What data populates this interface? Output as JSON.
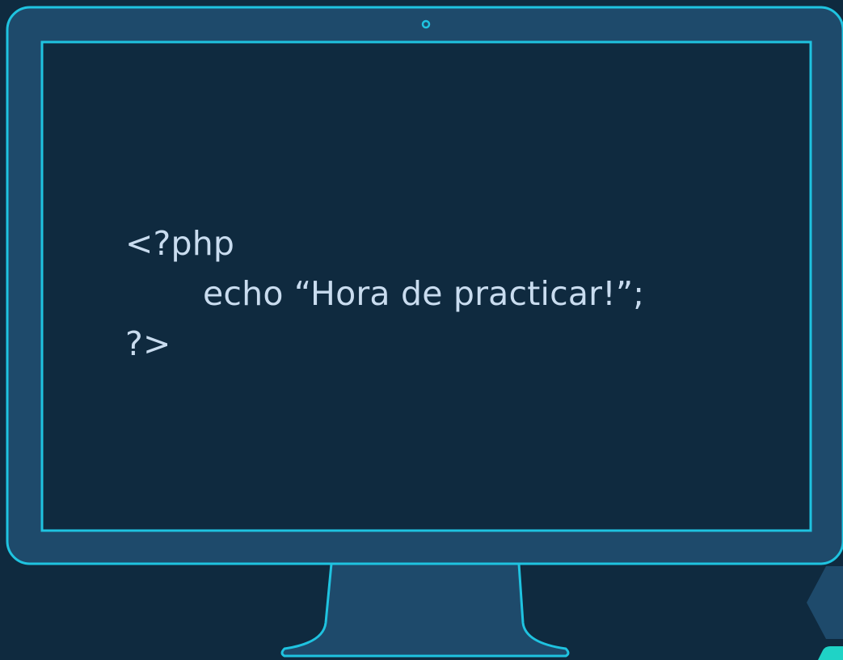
{
  "colors": {
    "background": "#0f2a3f",
    "monitor_body": "#1e4a6b",
    "screen": "#0f2a3f",
    "outline": "#1fc3e0",
    "code_text": "#c9dcef"
  },
  "screen": {
    "code_lines": [
      "<?php",
      "echo “Hora de practicar!”;",
      "?>"
    ]
  },
  "icons": {
    "camera": "webcam-dot-icon",
    "corner_shape": "hexagon-decoration-icon",
    "corner_accent": "corner-accent-icon"
  }
}
